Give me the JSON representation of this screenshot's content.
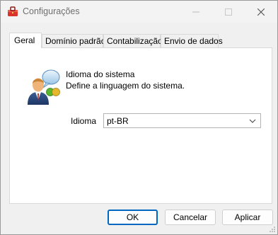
{
  "window": {
    "title": "Configurações",
    "app_icon": "toolbox-icon",
    "controls": {
      "minimize": "minimize-icon",
      "maximize": "maximize-icon",
      "close": "close-icon"
    }
  },
  "tabs": [
    {
      "label": "Geral",
      "active": true
    },
    {
      "label": "Domínio padrão",
      "active": false
    },
    {
      "label": "Contabilização",
      "active": false
    },
    {
      "label": "Envio de dados",
      "active": false
    }
  ],
  "general": {
    "icon": "user-speech-bubble-icon",
    "section_title": "Idioma do sistema",
    "section_description": "Define a linguagem do sistema.",
    "language_label": "Idioma",
    "language_value": "pt-BR"
  },
  "buttons": {
    "ok": "OK",
    "cancel": "Cancelar",
    "apply": "Aplicar"
  },
  "colors": {
    "accent": "#0067c0",
    "panel": "#ffffff",
    "dialog": "#f0f0f0"
  }
}
